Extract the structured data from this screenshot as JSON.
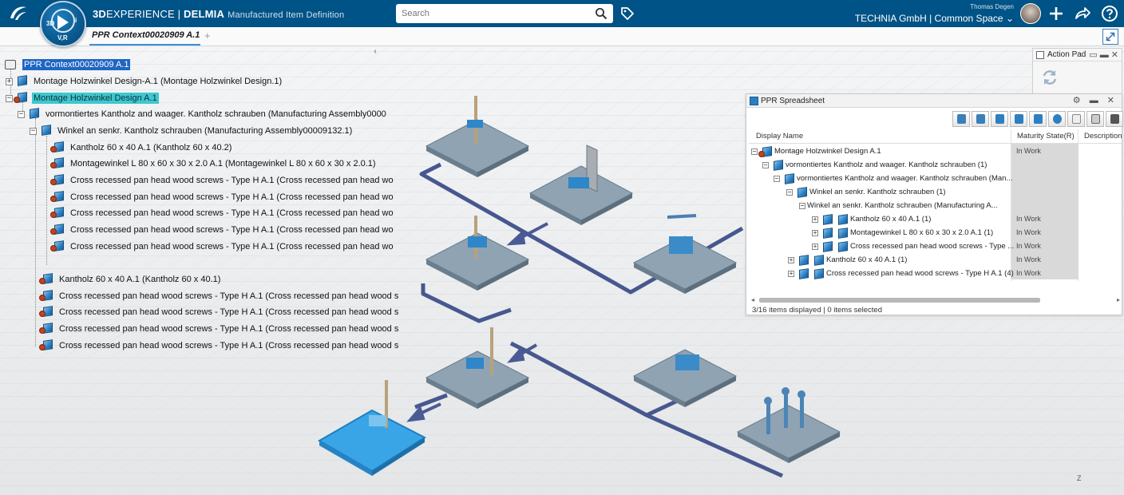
{
  "topbar": {
    "brand_bold": "3D",
    "brand_light": "EXPERIENCE | ",
    "brand_app": "DELMIA",
    "app_subtitle": "Manufactured Item Definition",
    "compass": {
      "left": "3D",
      "right": "i",
      "bottom": "V,R"
    },
    "search_placeholder": "Search",
    "user_name": "Thomas Degen",
    "tenant": "TECHNIA GmbH | Common Space",
    "tenant_chevron": "⌄",
    "color": "#005386"
  },
  "tabs": [
    {
      "label": "PPR Context00020909 A.1"
    }
  ],
  "tab_add": "+",
  "tree": {
    "collapse_glyph": "‹",
    "rows": [
      {
        "label": "PPR Context00020909 A.1"
      },
      {
        "label": "Montage Holzwinkel Design-A.1 (Montage Holzwinkel Design.1)"
      },
      {
        "label": "Montage Holzwinkel Design A.1"
      },
      {
        "label": "vormontiertes Kantholz and waager. Kantholz schrauben (Manufacturing Assembly0000"
      },
      {
        "label": "Winkel an senkr. Kantholz schrauben (Manufacturing Assembly00009132.1)"
      },
      {
        "label": "Kantholz 60 x 40 A.1 (Kantholz 60 x 40.2)"
      },
      {
        "label": "Montagewinkel L 80 x 60 x 30 x 2.0 A.1 (Montagewinkel L 80 x 60 x 30 x 2.0.1)"
      },
      {
        "label": "Cross recessed pan head wood screws - Type H A.1 (Cross recessed pan head wo"
      },
      {
        "label": "Cross recessed pan head wood screws - Type H A.1 (Cross recessed pan head wo"
      },
      {
        "label": "Cross recessed pan head wood screws - Type H A.1 (Cross recessed pan head wo"
      },
      {
        "label": "Cross recessed pan head wood screws - Type H A.1 (Cross recessed pan head wo"
      },
      {
        "label": "Cross recessed pan head wood screws - Type H A.1 (Cross recessed pan head wo"
      },
      {
        "label": "Kantholz 60 x 40 A.1 (Kantholz 60 x 40.1)"
      },
      {
        "label": "Cross recessed pan head wood screws - Type H A.1 (Cross recessed pan head wood s"
      },
      {
        "label": "Cross recessed pan head wood screws - Type H A.1 (Cross recessed pan head wood s"
      },
      {
        "label": "Cross recessed pan head wood screws - Type H A.1 (Cross recessed pan head wood s"
      },
      {
        "label": "Cross recessed pan head wood screws - Type H A.1 (Cross recessed pan head wood s"
      }
    ]
  },
  "action_pad": {
    "title": "Action Pad",
    "controls": "▭ ▬ ✕"
  },
  "spreadsheet": {
    "title": "PPR Spreadsheet",
    "controls": "⚙ ▬ ✕",
    "columns": [
      "Display Name",
      "Maturity State(R)",
      "Description"
    ],
    "rows": [
      {
        "name": "Montage Holzwinkel Design A.1",
        "state": "In Work"
      },
      {
        "name": "vormontiertes Kantholz and waager. Kantholz schrauben (1)",
        "state": ""
      },
      {
        "name": "vormontiertes Kantholz and waager. Kantholz schrauben (Man...",
        "state": ""
      },
      {
        "name": "Winkel an senkr. Kantholz schrauben (1)",
        "state": ""
      },
      {
        "name": "Winkel an senkr. Kantholz schrauben (Manufacturing A...",
        "state": ""
      },
      {
        "name": "Kantholz 60 x 40 A.1 (1)",
        "state": "In Work"
      },
      {
        "name": "Montagewinkel L 80 x 60 x 30 x 2.0 A.1 (1)",
        "state": "In Work"
      },
      {
        "name": "Cross recessed pan head wood screws - Type ...",
        "state": "In Work"
      },
      {
        "name": "Kantholz 60 x 40 A.1 (1)",
        "state": "In Work"
      },
      {
        "name": "Cross recessed pan head wood screws - Type H A.1 (4)",
        "state": "In Work"
      }
    ],
    "status": "3/16 items displayed | 0 items selected"
  },
  "axis_label": "Z"
}
